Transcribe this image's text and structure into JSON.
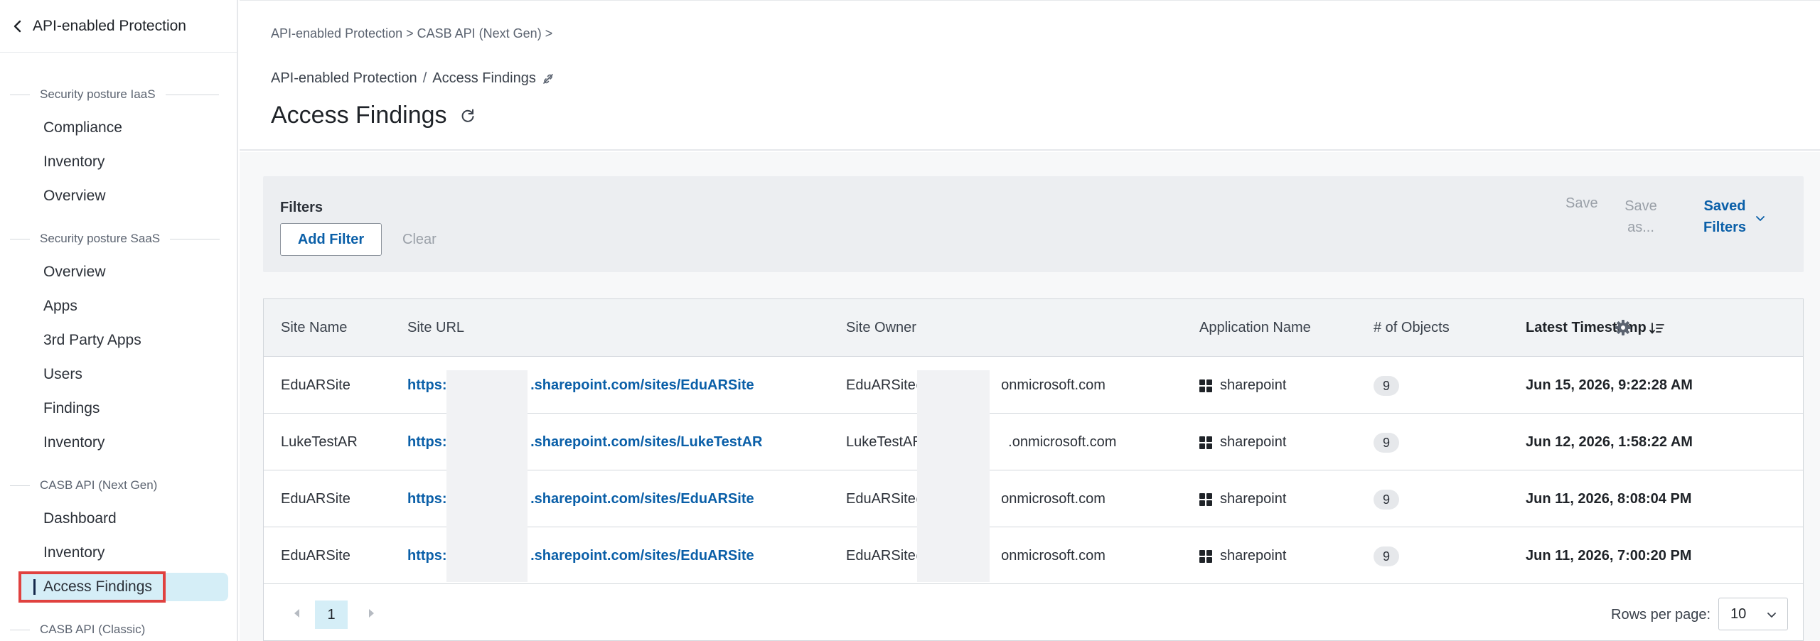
{
  "sidebar": {
    "title": "API-enabled Protection",
    "sections": [
      {
        "label": "Security posture IaaS",
        "items": [
          "Compliance",
          "Inventory",
          "Overview"
        ]
      },
      {
        "label": "Security posture SaaS",
        "items": [
          "Overview",
          "Apps",
          "3rd Party Apps",
          "Users",
          "Findings",
          "Inventory"
        ]
      },
      {
        "label": "CASB API (Next Gen)",
        "items": [
          "Dashboard",
          "Inventory",
          "Access Findings"
        ]
      },
      {
        "label": "CASB API (Classic)",
        "items": []
      }
    ],
    "active_item": "Access Findings"
  },
  "header": {
    "top_breadcrumb": "API-enabled Protection > CASB API (Next Gen) >",
    "breadcrumb": [
      "API-enabled Protection",
      "Access Findings"
    ],
    "breadcrumb_separator": "/",
    "title": "Access Findings"
  },
  "filters": {
    "label": "Filters",
    "add_filter": "Add Filter",
    "clear": "Clear",
    "save": "Save",
    "save_as": "Save as...",
    "saved_filters": "Saved Filters"
  },
  "table": {
    "columns": [
      "Site Name",
      "Site URL",
      "Site Owner",
      "Application Name",
      "# of Objects",
      "Latest Timestamp"
    ],
    "sorted_column": "Latest Timestamp",
    "rows": [
      {
        "site_name": "EduARSite",
        "url_prefix": "https:/",
        "url_suffix": ".sharepoint.com/sites/EduARSite",
        "owner_prefix": "EduARSite@",
        "owner_suffix": "onmicrosoft.com",
        "app": "sharepoint",
        "objects": "9",
        "timestamp": "Jun 15, 2026, 9:22:28 AM"
      },
      {
        "site_name": "LukeTestAR",
        "url_prefix": "https:/",
        "url_suffix": ".sharepoint.com/sites/LukeTestAR",
        "owner_prefix": "LukeTestAR@",
        "owner_suffix": ".onmicrosoft.com",
        "app": "sharepoint",
        "objects": "9",
        "timestamp": "Jun 12, 2026, 1:58:22 AM"
      },
      {
        "site_name": "EduARSite",
        "url_prefix": "https:/",
        "url_suffix": ".sharepoint.com/sites/EduARSite",
        "owner_prefix": "EduARSite@",
        "owner_suffix": "onmicrosoft.com",
        "app": "sharepoint",
        "objects": "9",
        "timestamp": "Jun 11, 2026, 8:08:04 PM"
      },
      {
        "site_name": "EduARSite",
        "url_prefix": "https:/",
        "url_suffix": ".sharepoint.com/sites/EduARSite",
        "owner_prefix": "EduARSite@",
        "owner_suffix": "onmicrosoft.com",
        "app": "sharepoint",
        "objects": "9",
        "timestamp": "Jun 11, 2026, 7:00:20 PM"
      }
    ]
  },
  "pagination": {
    "current_page": "1",
    "rows_per_page_label": "Rows per page:",
    "rows_per_page": "10"
  },
  "icons": {
    "back": "chevron-left-icon",
    "link": "link-icon",
    "refresh": "refresh-icon",
    "sort": "sort-descending-icon",
    "settings": "gear-icon",
    "app": "grid-icon",
    "dropdown": "chevron-down-icon",
    "prev": "caret-left-icon",
    "next": "caret-right-icon"
  },
  "colors": {
    "link": "#0a5fa8",
    "active_nav_bg": "#d5eef7",
    "highlight_box": "#e0413f"
  }
}
